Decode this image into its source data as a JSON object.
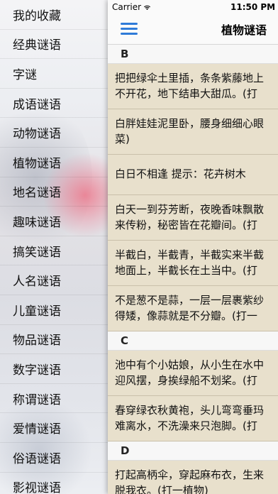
{
  "sidebar": {
    "items": [
      {
        "label": "我的收藏"
      },
      {
        "label": "经典谜语"
      },
      {
        "label": "字谜"
      },
      {
        "label": "成语谜语"
      },
      {
        "label": "动物谜语"
      },
      {
        "label": "植物谜语"
      },
      {
        "label": "地名谜语"
      },
      {
        "label": "趣味谜语"
      },
      {
        "label": "搞笑谜语"
      },
      {
        "label": "人名谜语"
      },
      {
        "label": "儿童谜语"
      },
      {
        "label": "物品谜语"
      },
      {
        "label": "数字谜语"
      },
      {
        "label": "称谓谜语"
      },
      {
        "label": "爱情谜语"
      },
      {
        "label": "俗语谜语"
      },
      {
        "label": "影视谜语"
      }
    ]
  },
  "status": {
    "carrier": "Carrier",
    "time": "11:50 PM"
  },
  "nav": {
    "title": "植物谜语",
    "menu_icon": "hamburger-icon"
  },
  "sections": [
    {
      "header": "B",
      "riddles": [
        {
          "lines": [
            "把把绿伞土里插，条条紫藤地上",
            "不开花，地下结串大甜瓜。(打"
          ]
        },
        {
          "lines": [
            "白胖娃娃泥里卧，腰身细细心眼",
            "菜)"
          ]
        },
        {
          "lines": [
            "白日不相逢  提示：花卉树木"
          ]
        },
        {
          "lines": [
            "白天一到芬芳断，夜晚香味飘散",
            "来传粉，秘密皆在花瓣间。(打"
          ]
        },
        {
          "lines": [
            "半截白，半截青，半截实来半截",
            "地面上，半截长在土当中。(打"
          ]
        },
        {
          "lines": [
            "不是葱不是蒜，一层一层裹紫纱",
            "得矮，像蒜就是不分瓣。(打一"
          ]
        }
      ]
    },
    {
      "header": "C",
      "riddles": [
        {
          "lines": [
            "池中有个小姑娘，从小生在水中",
            "迎风摆，身挨绿船不划桨。(打"
          ]
        },
        {
          "lines": [
            "春穿绿衣秋黄袍，头儿弯弯垂玛",
            "难离水，不洗澡来只泡脚。(打"
          ]
        }
      ]
    },
    {
      "header": "D",
      "riddles": [
        {
          "lines": [
            "打起高柄伞，穿起麻布衣，生来",
            "脱我衣。(打一植物)"
          ]
        }
      ]
    }
  ]
}
